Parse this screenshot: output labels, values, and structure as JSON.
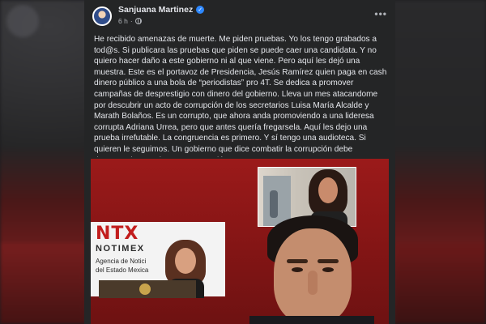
{
  "post": {
    "author": "Sanjuana Martinez",
    "time": "6 h",
    "separator": "·",
    "more_label": "•••",
    "verified_mark": "✓",
    "text": "He recibido amenazas de muerte. Me piden pruebas. Yo los tengo grabados a tod@s. Si publicara las pruebas que piden se puede caer una candidata. Y no quiero hacer daño a este gobierno ni al que viene. Pero aquí les dejó una muestra. Este es el portavoz de Presidencia, Jesús Ramírez quien paga en cash dinero público a una bola de “periodistas” pro 4T. Se dedica a promover campañas de desprestigio con dinero del gobierno. Lleva un mes atacandome por descubrir un acto de corrupción de los secretarios Luisa María Alcalde y Marath Bolaños. Es un corrupto, que ahora anda promoviendo a una lideresa corrupta Adriana Urrea, pero que antes quería fregarsela. Aquí les dejo una prueba irrefutable. La congruencia es primero. Y sí tengo una audioteca. Si quieren le seguimos. Un gobierno que dice combatir la corrupción debe demostrarlo. Gracias por su atención y apoyo."
  },
  "media": {
    "logo_text": "NTX",
    "brand_word": "NOTIMEX",
    "brand_sub_1": "Agencia de Notici",
    "brand_sub_2": "del Estado Mexica"
  },
  "icons": {
    "verified": "verified-badge-icon",
    "audience": "globe-icon",
    "menu": "more-options-icon"
  },
  "colors": {
    "card_bg": "#242526",
    "text_primary": "#e4e6eb",
    "text_secondary": "#b0b3b8",
    "verified_blue": "#2d88ff",
    "media_red": "#8a1616"
  }
}
